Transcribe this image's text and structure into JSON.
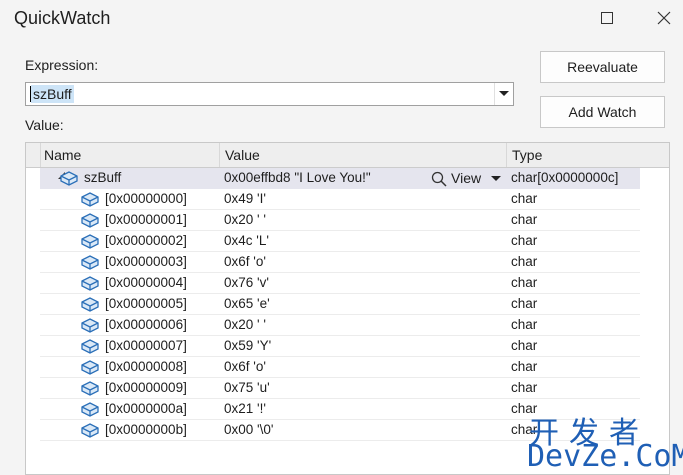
{
  "window": {
    "title": "QuickWatch"
  },
  "expression": {
    "label": "Expression:",
    "value": "szBuff"
  },
  "buttons": {
    "reevaluate": "Reevaluate",
    "add_watch": "Add Watch"
  },
  "value_label": "Value:",
  "grid": {
    "columns": [
      "Name",
      "Value",
      "Type"
    ],
    "root": {
      "name": "szBuff",
      "value": "0x00effbd8 \"I Love You!\"",
      "view_label": "View",
      "type": "char[0x0000000c]"
    },
    "rows": [
      {
        "name": "[0x00000000]",
        "value": "0x49 'I'",
        "type": "char"
      },
      {
        "name": "[0x00000001]",
        "value": "0x20 ' '",
        "type": "char"
      },
      {
        "name": "[0x00000002]",
        "value": "0x4c 'L'",
        "type": "char"
      },
      {
        "name": "[0x00000003]",
        "value": "0x6f 'o'",
        "type": "char"
      },
      {
        "name": "[0x00000004]",
        "value": "0x76 'v'",
        "type": "char"
      },
      {
        "name": "[0x00000005]",
        "value": "0x65 'e'",
        "type": "char"
      },
      {
        "name": "[0x00000006]",
        "value": "0x20 ' '",
        "type": "char"
      },
      {
        "name": "[0x00000007]",
        "value": "0x59 'Y'",
        "type": "char"
      },
      {
        "name": "[0x00000008]",
        "value": "0x6f 'o'",
        "type": "char"
      },
      {
        "name": "[0x00000009]",
        "value": "0x75 'u'",
        "type": "char"
      },
      {
        "name": "[0x0000000a]",
        "value": "0x21 '!'",
        "type": "char"
      },
      {
        "name": "[0x0000000b]",
        "value": "0x00 '\\0'",
        "type": "char"
      }
    ]
  },
  "watermark": {
    "cn": "开发者",
    "en": "DevZe.CoM"
  },
  "colors": {
    "background": "#f4f4f4",
    "selection": "#e5e5ee",
    "icon": "#2b6fb8",
    "watermark": "#1f5fb5"
  }
}
